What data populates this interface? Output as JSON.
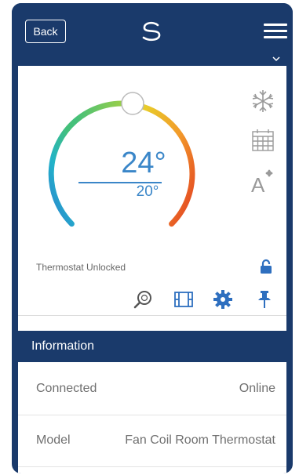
{
  "topbar": {
    "back_label": "Back",
    "logo_icon": "swirl-logo-icon",
    "menu_icon": "hamburger-menu-icon"
  },
  "thermostat": {
    "current_temp": "24°",
    "set_temp": "20°",
    "status": "Thermostat Unlocked",
    "side_icons": [
      "snowflake-icon",
      "calendar-icon",
      "fan-auto-icon"
    ],
    "bottom_icons": [
      "search-icon",
      "film-icon",
      "gear-icon",
      "pin-icon"
    ],
    "lock_icon": "unlocked-lock-icon"
  },
  "information": {
    "header": "Information",
    "rows": [
      {
        "label": "Connected",
        "value": "Online"
      },
      {
        "label": "Model",
        "value": "Fan Coil Room Thermostat"
      }
    ]
  },
  "colors": {
    "brand": "#1a3a6b",
    "accent": "#3a86c8"
  }
}
